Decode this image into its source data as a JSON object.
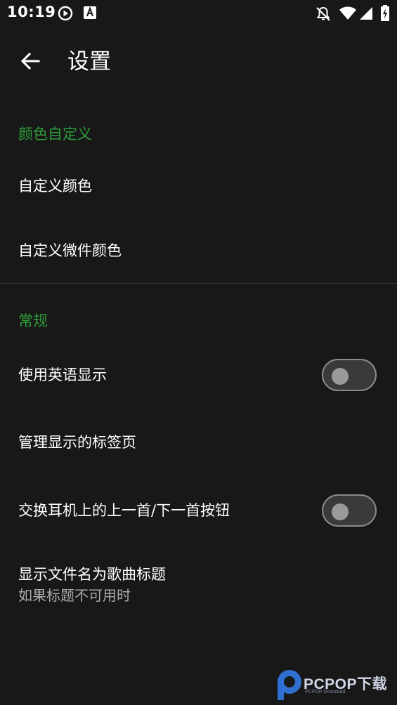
{
  "status_bar": {
    "time": "10:19",
    "icons": [
      "play-circle-icon",
      "a-box-icon",
      "notifications-off-icon",
      "wifi-icon",
      "cell-signal-icon",
      "battery-charging-icon"
    ]
  },
  "app_bar": {
    "title": "设置",
    "back_icon": "arrow-back-icon"
  },
  "sections": [
    {
      "header": "颜色自定义",
      "items": [
        {
          "title": "自定义颜色"
        },
        {
          "title": "自定义微件颜色"
        }
      ]
    },
    {
      "header": "常规",
      "items": [
        {
          "title": "使用英语显示",
          "switch": false
        },
        {
          "title": "管理显示的标签页"
        },
        {
          "title": "交换耳机上的上一首/下一首按钮",
          "switch": false
        },
        {
          "title": "显示文件名为歌曲标题",
          "summary": "如果标题不可用时"
        }
      ]
    }
  ],
  "colors": {
    "background": "#181818",
    "accent": "#2e9d3a",
    "divider": "#3c3c3c",
    "summary_text": "#a9a9a9"
  }
}
